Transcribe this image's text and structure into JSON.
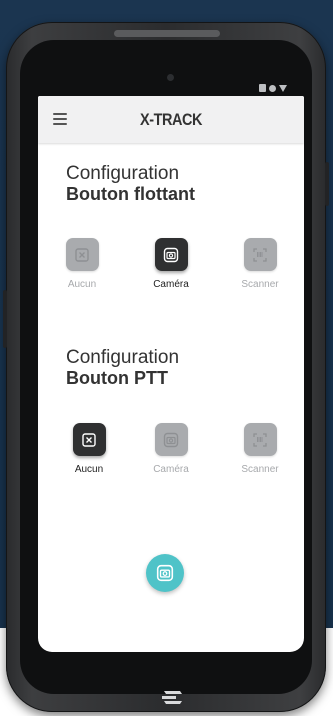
{
  "app": {
    "title": "X-TRACK"
  },
  "section_floating": {
    "title_line1": "Configuration",
    "title_line2": "Bouton flottant",
    "options": [
      {
        "label": "Aucun",
        "icon": "close-icon",
        "selected": false
      },
      {
        "label": "Caméra",
        "icon": "camera-icon",
        "selected": true
      },
      {
        "label": "Scanner",
        "icon": "barcode-scan-icon",
        "selected": false
      }
    ]
  },
  "section_ptt": {
    "title_line1": "Configuration",
    "title_line2": "Bouton PTT",
    "options": [
      {
        "label": "Aucun",
        "icon": "close-icon",
        "selected": true
      },
      {
        "label": "Caméra",
        "icon": "camera-icon",
        "selected": false
      },
      {
        "label": "Scanner",
        "icon": "barcode-scan-icon",
        "selected": false
      }
    ]
  },
  "fab": {
    "icon": "camera-icon"
  },
  "colors": {
    "background": "#17324d",
    "appbar": "#f1f1f2",
    "tile_selected": "#2f3031",
    "tile_unselected": "#a9abae",
    "fab": "#4fc3c8"
  }
}
